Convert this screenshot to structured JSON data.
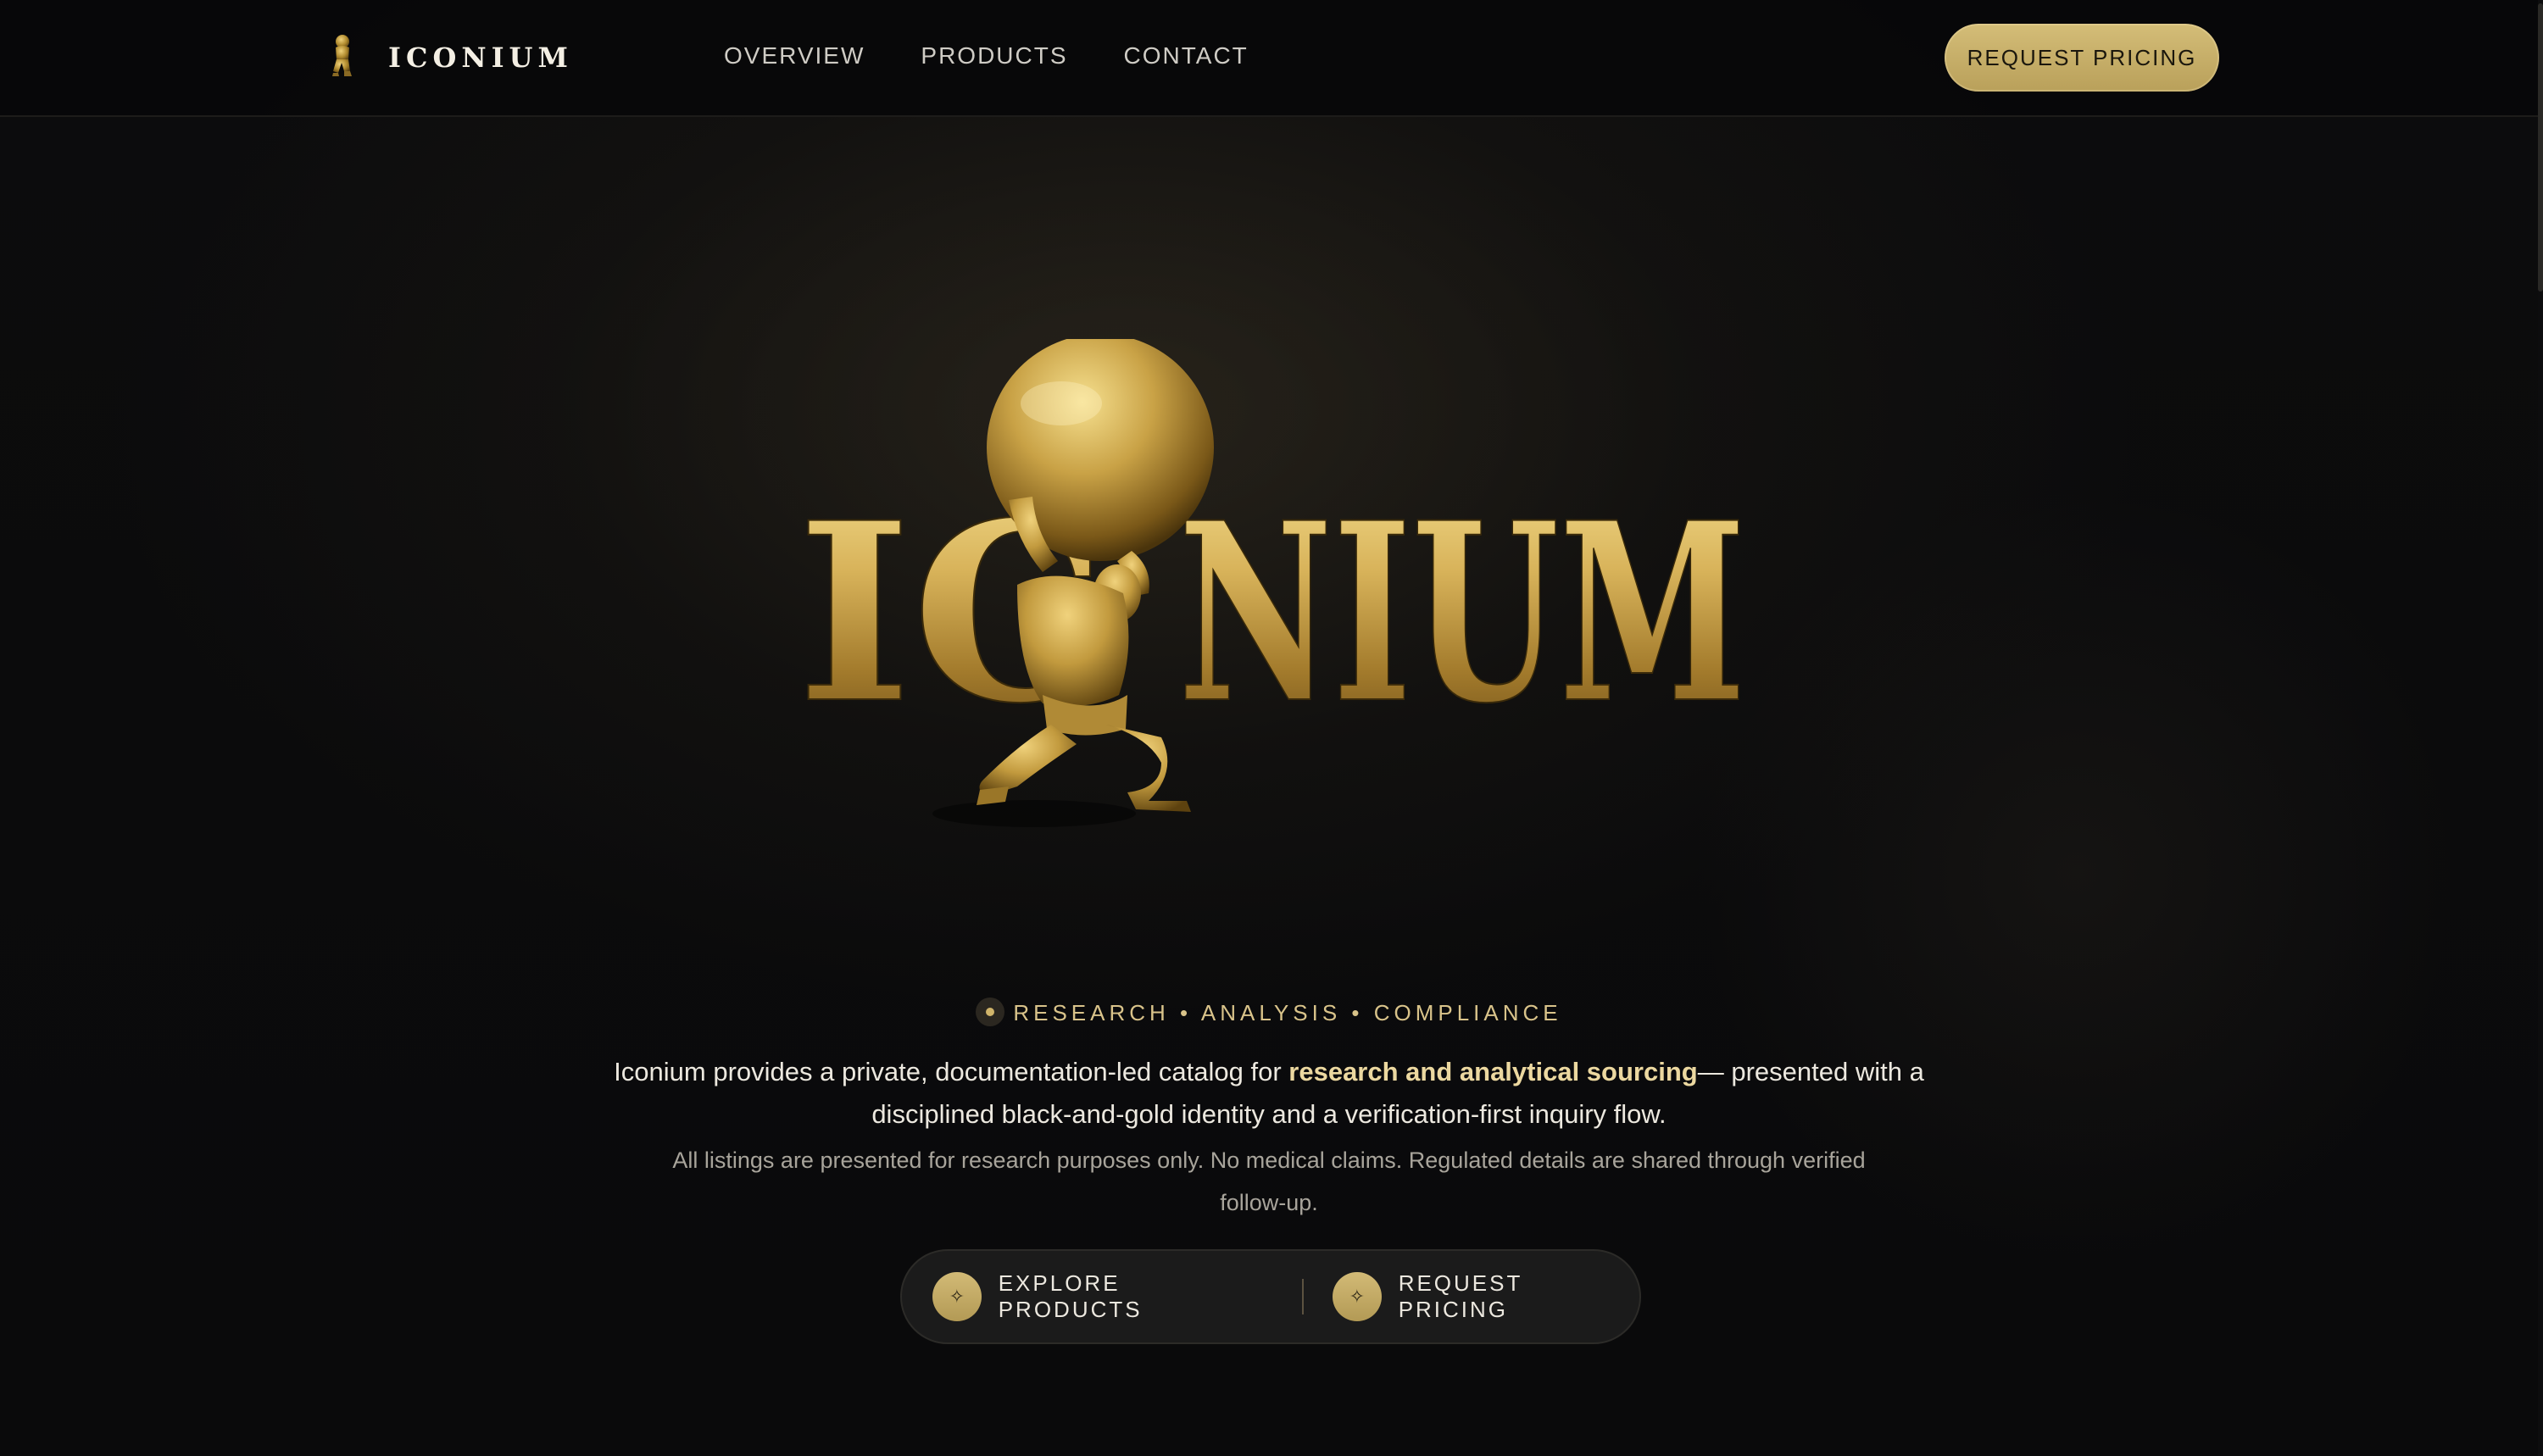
{
  "brand": {
    "name": "ICONIUM"
  },
  "nav": {
    "links": [
      {
        "label": "OVERVIEW"
      },
      {
        "label": "PRODUCTS"
      },
      {
        "label": "CONTACT"
      }
    ],
    "cta_label": "REQUEST PRICING"
  },
  "hero": {
    "logo_text_left": "IC",
    "logo_text_right": "NIUM",
    "tagline": "RESEARCH • ANALYSIS • COMPLIANCE",
    "lead_before": "Iconium provides a private, documentation-led catalog for ",
    "lead_highlight": "research and analytical sourcing",
    "lead_after": "— presented with a disciplined black-and-gold identity and a verification-first inquiry flow.",
    "note": "All listings are presented for research purposes only. No medical claims. Regulated details are shared through verified follow-up.",
    "buttons": [
      {
        "label": "EXPLORE PRODUCTS",
        "icon": "sparkle-icon"
      },
      {
        "label": "REQUEST PRICING",
        "icon": "sparkle-icon"
      }
    ]
  },
  "colors": {
    "background": "#09090a",
    "gold": "#c9b06a",
    "gold_light": "#ecd8a0",
    "text": "#ece8df",
    "muted": "#a8a49b"
  }
}
